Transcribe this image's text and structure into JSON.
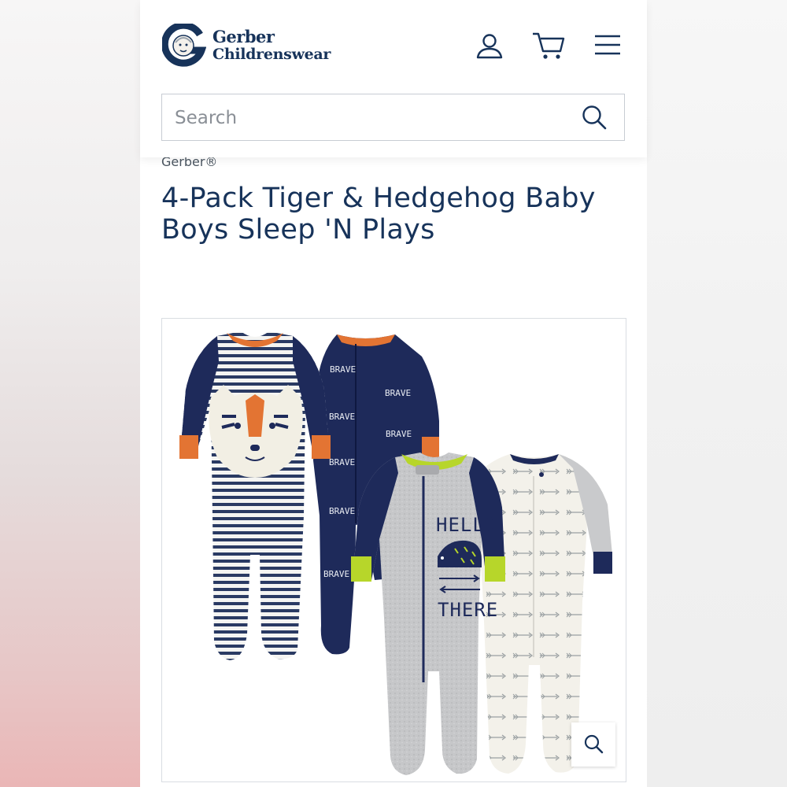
{
  "header": {
    "logo": {
      "line1": "Gerber",
      "line2": "Childrenswear"
    },
    "icons": [
      "account-icon",
      "cart-icon",
      "menu-icon"
    ]
  },
  "search": {
    "placeholder": "Search",
    "value": ""
  },
  "product": {
    "brand": "Gerber®",
    "title": "4-Pack Tiger & Hedgehog Baby Boys Sleep 'N Plays",
    "image_text": {
      "brave": "BRAVE",
      "hello": "HELLO",
      "there": "THERE"
    }
  },
  "colors": {
    "navy": "#17335a",
    "orange": "#e37433",
    "lime": "#b7d62a",
    "heather_gray": "#c9cacc",
    "cream": "#f3f1ea"
  }
}
